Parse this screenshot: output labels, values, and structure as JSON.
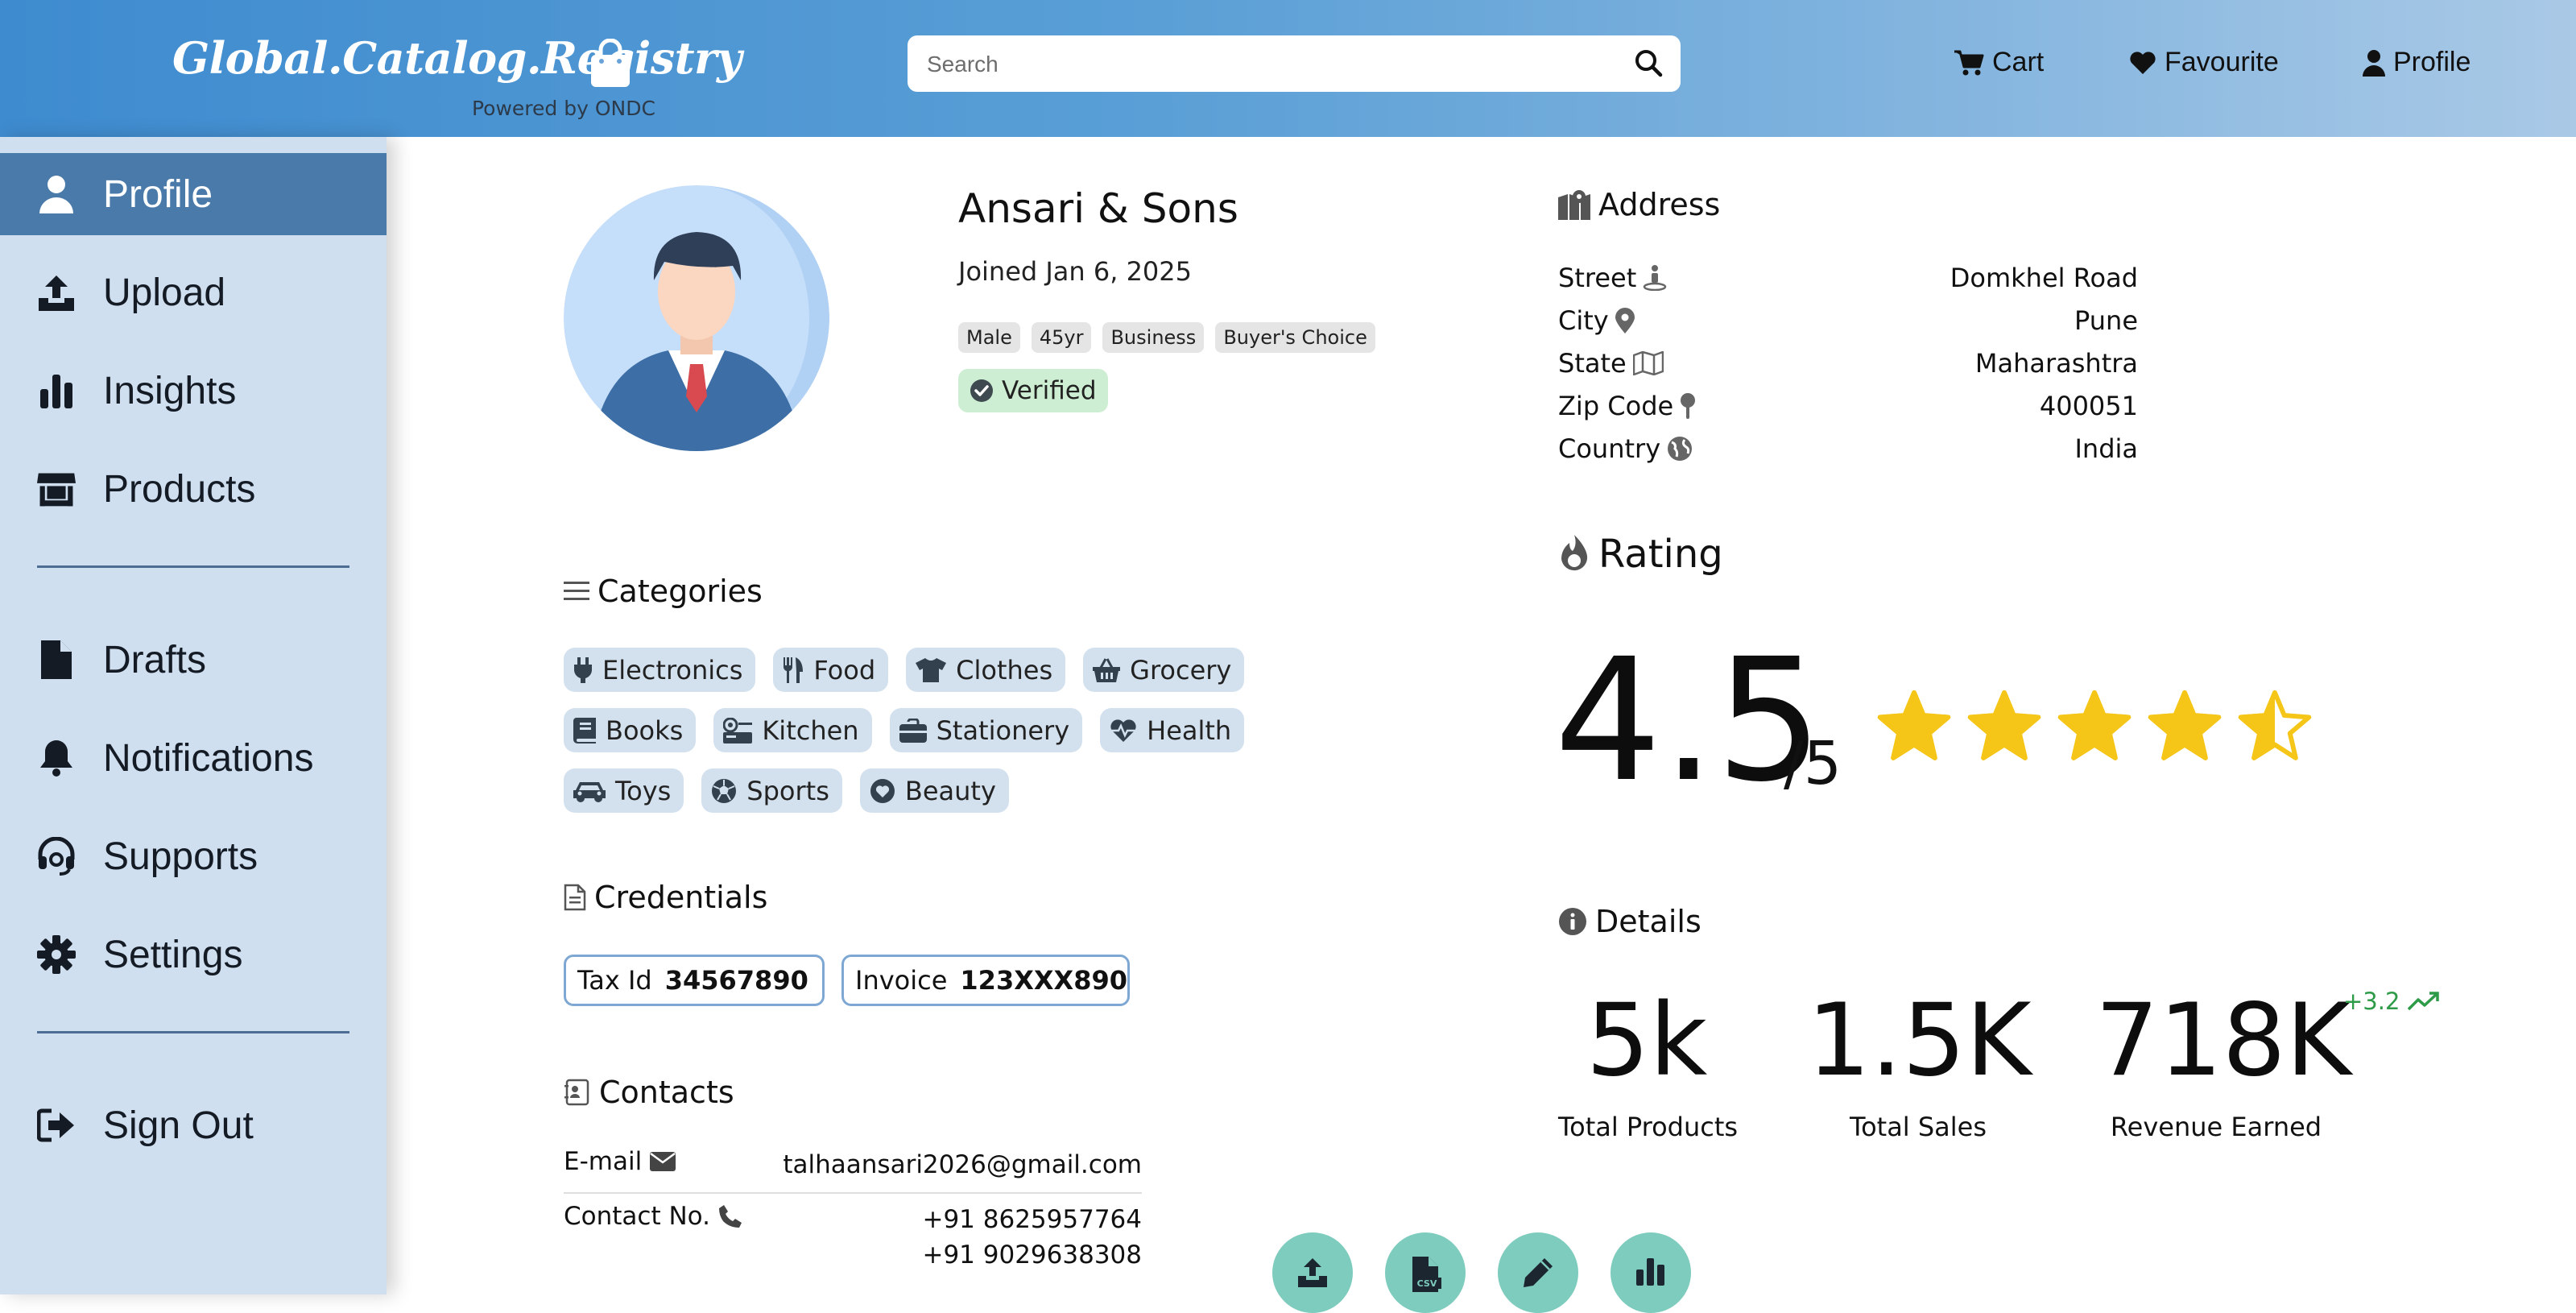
{
  "header": {
    "logo_text": "Global.Catalog.Registry",
    "logo_subtitle": "Powered by ONDC",
    "search_placeholder": "Search",
    "nav": {
      "cart": "Cart",
      "favourite": "Favourite",
      "profile": "Profile"
    }
  },
  "sidebar": {
    "items": [
      {
        "label": "Profile",
        "icon": "user-icon",
        "active": true
      },
      {
        "label": "Upload",
        "icon": "upload-icon"
      },
      {
        "label": "Insights",
        "icon": "bar-chart-icon"
      },
      {
        "label": "Products",
        "icon": "store-icon"
      },
      {
        "label": "Drafts",
        "icon": "file-icon"
      },
      {
        "label": "Notifications",
        "icon": "bell-icon"
      },
      {
        "label": "Supports",
        "icon": "headset-icon"
      },
      {
        "label": "Settings",
        "icon": "gear-icon"
      },
      {
        "label": "Sign Out",
        "icon": "sign-out-icon"
      }
    ]
  },
  "profile": {
    "name": "Ansari & Sons",
    "joined": "Joined Jan 6, 2025",
    "tags": [
      "Male",
      "45yr",
      "Business",
      "Buyer's Choice"
    ],
    "verified": "Verified"
  },
  "categories": {
    "title": "Categories",
    "items": [
      "Electronics",
      "Food",
      "Clothes",
      "Grocery",
      "Books",
      "Kitchen",
      "Stationery",
      "Health",
      "Toys",
      "Sports",
      "Beauty"
    ]
  },
  "credentials": {
    "title": "Credentials",
    "tax_label": "Tax Id",
    "tax_value": "34567890",
    "invoice_label": "Invoice",
    "invoice_value": "123XXX890"
  },
  "contacts": {
    "title": "Contacts",
    "email_label": "E-mail",
    "email_value": "talhaansari2026@gmail.com",
    "phone_label": "Contact No.",
    "phone_1": "+91 8625957764",
    "phone_2": "+91 9029638308"
  },
  "address": {
    "title": "Address",
    "rows": [
      {
        "label": "Street",
        "value": "Domkhel Road",
        "icon": "street-view-icon"
      },
      {
        "label": "City",
        "value": "Pune",
        "icon": "location-pin-icon"
      },
      {
        "label": "State",
        "value": "Maharashtra",
        "icon": "map-icon"
      },
      {
        "label": "Zip Code",
        "value": "400051",
        "icon": "map-pin-icon"
      },
      {
        "label": "Country",
        "value": "India",
        "icon": "globe-icon"
      }
    ]
  },
  "rating": {
    "title": "Rating",
    "value": "4.5",
    "out_of": "/5",
    "stars": 4.5,
    "star_color": "#f5c518"
  },
  "details": {
    "title": "Details",
    "stats": [
      {
        "value": "5k",
        "label": "Total Products"
      },
      {
        "value": "1.5K",
        "label": "Total Sales"
      },
      {
        "value": "718K",
        "label": "Revenue Earned"
      }
    ],
    "trend": "+3.2",
    "trend_color": "#2e9b48"
  },
  "actions": [
    "upload-icon",
    "csv-file-icon",
    "pencil-icon",
    "bar-chart-icon"
  ]
}
